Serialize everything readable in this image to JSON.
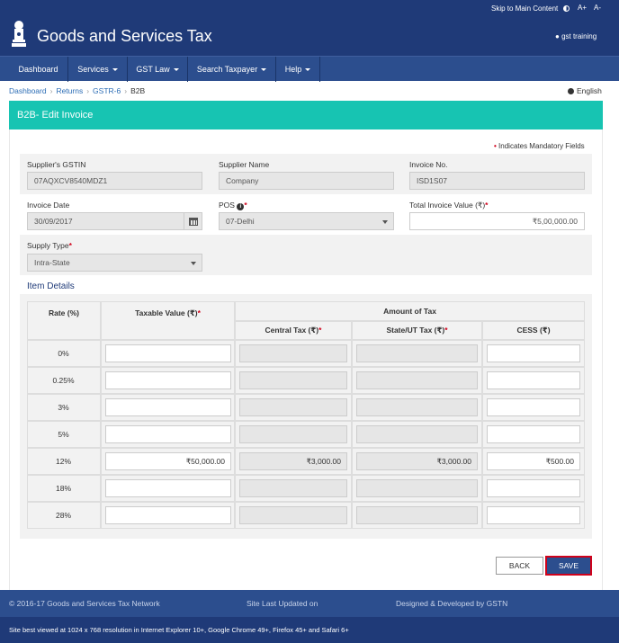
{
  "header": {
    "skip_link": "Skip to Main Content",
    "font_increase": "A+",
    "font_decrease": "A-",
    "site_title": "Goods and Services Tax",
    "user": "gst training"
  },
  "nav": {
    "items": [
      {
        "label": "Dashboard",
        "has_dropdown": false
      },
      {
        "label": "Services",
        "has_dropdown": true
      },
      {
        "label": "GST Law",
        "has_dropdown": true
      },
      {
        "label": "Search Taxpayer",
        "has_dropdown": true
      },
      {
        "label": "Help",
        "has_dropdown": true
      }
    ]
  },
  "breadcrumb": {
    "items": [
      "Dashboard",
      "Returns",
      "GSTR-6"
    ],
    "current": "B2B"
  },
  "language": "English",
  "page_title": "B2B- Edit Invoice",
  "mandatory_note": "Indicates Mandatory Fields",
  "form": {
    "supplier_gstin_label": "Supplier's GSTIN",
    "supplier_gstin_value": "07AQXCV8540MDZ1",
    "supplier_name_label": "Supplier Name",
    "supplier_name_value": "Company",
    "invoice_no_label": "Invoice No.",
    "invoice_no_value": "ISD1S07",
    "invoice_date_label": "Invoice Date",
    "invoice_date_value": "30/09/2017",
    "pos_label": "POS",
    "pos_value": "07-Delhi",
    "total_invoice_label": "Total Invoice Value (₹)",
    "total_invoice_value": "₹5,00,000.00",
    "supply_type_label": "Supply Type",
    "supply_type_value": "Intra-State"
  },
  "item_details": {
    "title": "Item Details",
    "headers": {
      "rate": "Rate (%)",
      "taxable_value": "Taxable Value (₹)",
      "amount_of_tax": "Amount of Tax",
      "central_tax": "Central Tax (₹)",
      "state_ut_tax": "State/UT Tax (₹)",
      "cess": "CESS (₹)"
    },
    "rows": [
      {
        "rate": "0%",
        "taxable": "",
        "central": "",
        "state": "",
        "cess": ""
      },
      {
        "rate": "0.25%",
        "taxable": "",
        "central": "",
        "state": "",
        "cess": ""
      },
      {
        "rate": "3%",
        "taxable": "",
        "central": "",
        "state": "",
        "cess": ""
      },
      {
        "rate": "5%",
        "taxable": "",
        "central": "",
        "state": "",
        "cess": ""
      },
      {
        "rate": "12%",
        "taxable": "₹50,000.00",
        "central": "₹3,000.00",
        "state": "₹3,000.00",
        "cess": "₹500.00"
      },
      {
        "rate": "18%",
        "taxable": "",
        "central": "",
        "state": "",
        "cess": ""
      },
      {
        "rate": "28%",
        "taxable": "",
        "central": "",
        "state": "",
        "cess": ""
      }
    ]
  },
  "buttons": {
    "back": "BACK",
    "save": "SAVE"
  },
  "footer": {
    "copyright": "© 2016-17 Goods and Services Tax Network",
    "last_updated": "Site Last Updated on",
    "designed_by": "Designed & Developed by GSTN",
    "browser_note": "Site best viewed at 1024 x 768 resolution in Internet Explorer 10+, Google Chrome 49+, Firefox 45+ and Safari 6+"
  },
  "colors": {
    "primary": "#1f3a78",
    "nav": "#2c4e8e",
    "teal": "#17c4b2",
    "required": "#d0021b"
  }
}
